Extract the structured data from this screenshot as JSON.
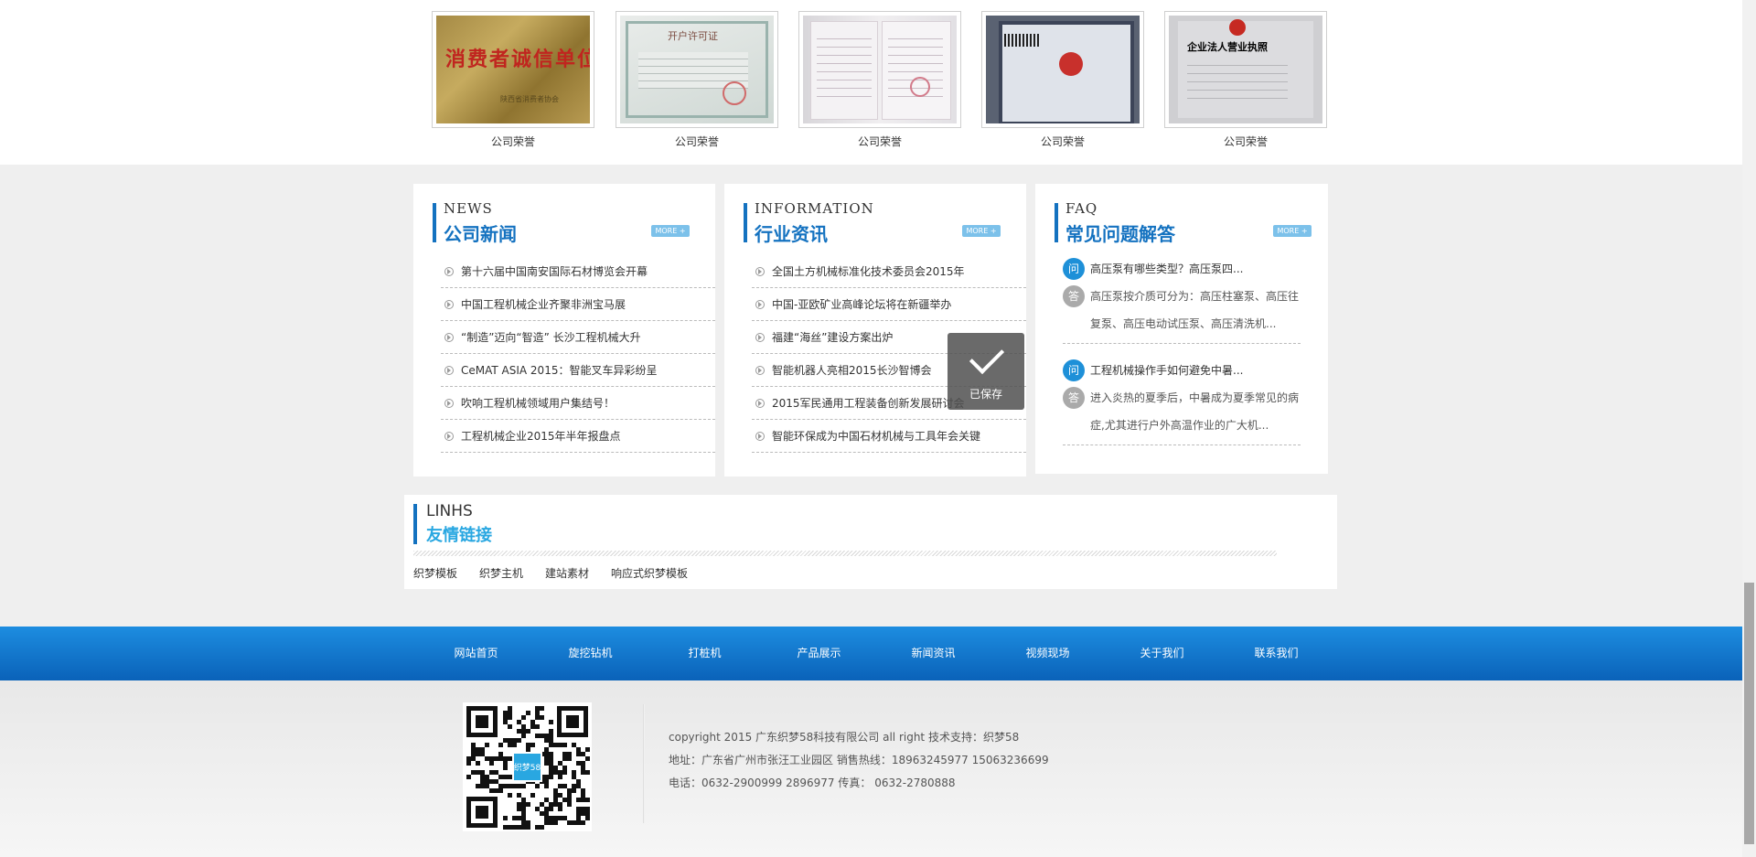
{
  "honors": {
    "items": [
      {
        "caption": "公司荣誉",
        "image_text": "消费者诚信单位",
        "image_sub": "陕西省消费者协会"
      },
      {
        "caption": "公司荣誉",
        "image_text": "开户许可证"
      },
      {
        "caption": "公司荣誉"
      },
      {
        "caption": "公司荣誉"
      },
      {
        "caption": "公司荣誉",
        "image_text": "企业法人营业执照"
      }
    ]
  },
  "columns": {
    "news": {
      "en": "NEWS",
      "cn": "公司新闻",
      "more": "MORE +",
      "items": [
        "第十六届中国南安国际石材博览会开幕",
        "中国工程机械企业齐聚非洲宝马展",
        "“制造”迈向“智造” 长沙工程机械大升",
        "CeMAT ASIA 2015：智能叉车异彩纷呈",
        "吹响工程机械领域用户集结号！",
        "工程机械企业2015年半年报盘点"
      ]
    },
    "info": {
      "en": "INFORMATION",
      "cn": "行业资讯",
      "more": "MORE +",
      "items": [
        "全国土方机械标准化技术委员会2015年",
        "中国-亚欧矿业高峰论坛将在新疆举办",
        "福建“海丝”建设方案出炉",
        "智能机器人亮相2015长沙智博会",
        "2015军民通用工程装备创新发展研讨会",
        "智能环保成为中国石材机械与工具年会关键"
      ]
    },
    "faq": {
      "en": "FAQ",
      "cn": "常见问题解答",
      "more": "MORE +",
      "q_badge": "问",
      "a_badge": "答",
      "items": [
        {
          "q": "高压泵有哪些类型？高压泵四...",
          "a1": "高压泵按介质可分为：高压柱塞泵、高压往",
          "a2": "复泵、高压电动试压泵、高压清洗机..."
        },
        {
          "q": "工程机械操作手如何避免中暑...",
          "a1": "进入炎热的夏季后，中暑成为夏季常见的病",
          "a2": "症,尤其进行户外高温作业的广大机..."
        }
      ]
    }
  },
  "toast": {
    "label": "已保存"
  },
  "links": {
    "en": "LINHS",
    "cn": "友情链接",
    "items": [
      "织梦模板",
      "织梦主机",
      "建站素材",
      "响应式织梦模板"
    ]
  },
  "nav": {
    "items": [
      "网站首页",
      "旋挖钻机",
      "打桩机",
      "产品展示",
      "新闻资讯",
      "视频现场",
      "关于我们",
      "联系我们"
    ]
  },
  "footer": {
    "qr_label": "织梦58",
    "copyright": "copyright 2015 广东织梦58科技有限公司 all right 技术支持：织梦58",
    "address": "地址：广东省广州市张汪工业园区 销售热线：18963245977 15063236699",
    "phone": "电话：0632-2900999 2896977 传真： 0632-2780888"
  },
  "colors": {
    "accent": "#1472c0",
    "nav_top": "#1d8de0",
    "nav_bottom": "#0a62b9",
    "link_title": "#29a7e1"
  }
}
